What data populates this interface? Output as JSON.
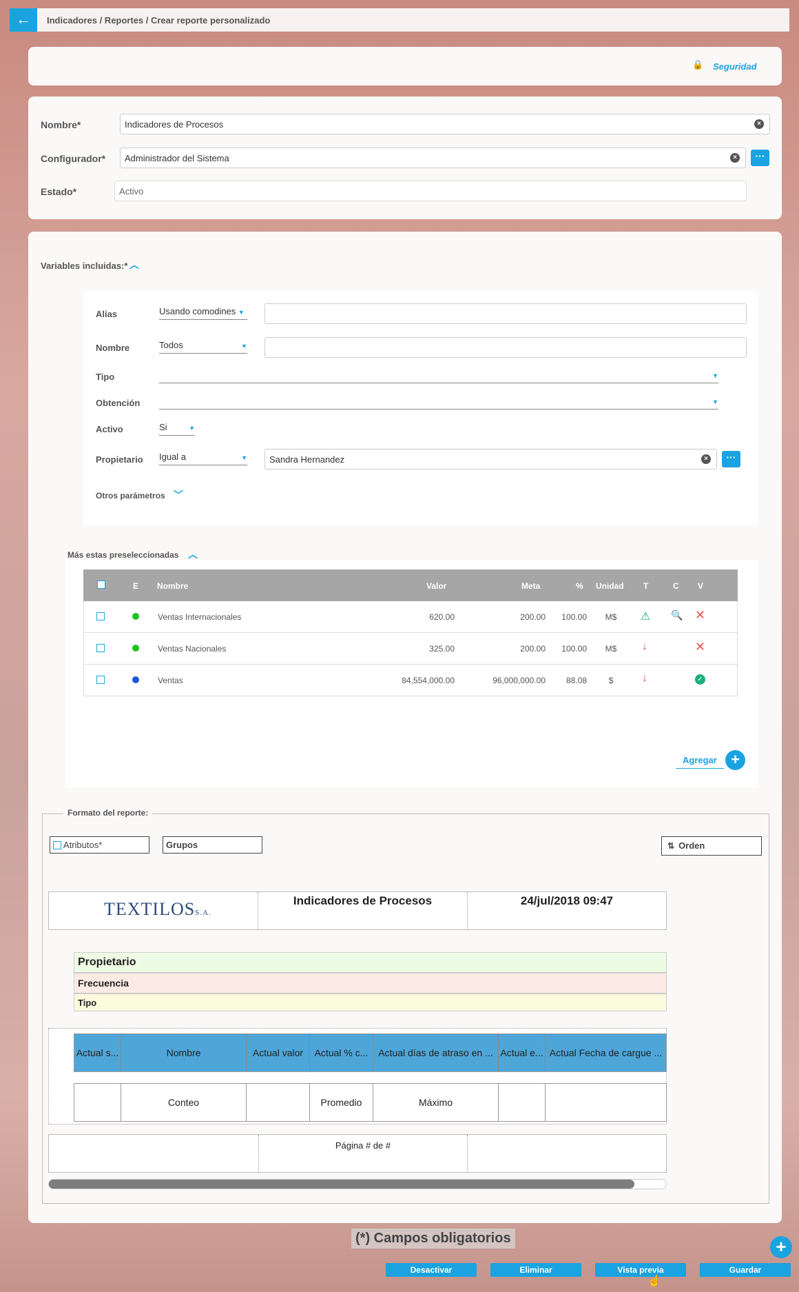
{
  "breadcrumb": "Indicadores / Reportes / Crear reporte personalizado",
  "security": {
    "label": "Seguridad"
  },
  "form": {
    "name_label": "Nombre*",
    "name_value": "Indicadores de Procesos",
    "config_label": "Configurador*",
    "config_value": "Administrador del Sistema",
    "state_label": "Estado*",
    "state_value": "Activo"
  },
  "variables": {
    "title": "Variables incluidas:*",
    "filters": {
      "alias_label": "Alias",
      "alias_mode": "Usando comodines",
      "nombre_label": "Nombre",
      "nombre_mode": "Todos",
      "tipo_label": "Tipo",
      "obtencion_label": "Obtención",
      "activo_label": "Activo",
      "activo_value": "Si",
      "propietario_label": "Propietario",
      "propietario_mode": "Igual a",
      "propietario_value": "Sandra Hernandez",
      "otros_label": "Otros parámetros"
    }
  },
  "preselected": {
    "title": "Más estas preseleccionadas",
    "headers": {
      "e": "E",
      "nombre": "Nombre",
      "valor": "Valor",
      "meta": "Meta",
      "pct": "%",
      "unidad": "Unidad",
      "t": "T",
      "c": "C",
      "v": "V"
    },
    "rows": [
      {
        "nombre": "Ventas Internacionales",
        "valor": "620.00",
        "meta": "200.00",
        "pct": "100.00",
        "unidad": "M$",
        "dot_color": "#1ec41e"
      },
      {
        "nombre": "Ventas Nacionales",
        "valor": "325.00",
        "meta": "200.00",
        "pct": "100.00",
        "unidad": "M$",
        "dot_color": "#1ec41e"
      },
      {
        "nombre": "Ventas",
        "valor": "84,554,000.00",
        "meta": "96,000,000.00",
        "pct": "88.08",
        "unidad": "$",
        "dot_color": "#1a56e0"
      }
    ],
    "add_label": "Agregar"
  },
  "format": {
    "title": "Formato del reporte:",
    "atributos": "Atributos*",
    "grupos": "Grupos",
    "orden": "Orden",
    "logo_main": "TEXTILOS",
    "logo_sub": "S.A.",
    "report_title": "Indicadores de Procesos",
    "report_date": "24/jul/2018 09:47",
    "groups": [
      "Propietario",
      "Frecuencia",
      "Tipo"
    ],
    "columns": [
      "Actual s...",
      "Nombre",
      "Actual valor",
      "Actual % c...",
      "Actual días de atraso en ...",
      "Actual e...",
      "Actual Fecha de cargue ..."
    ],
    "summary": [
      "",
      "Conteo",
      "",
      "Promedio",
      "Máximo",
      "",
      ""
    ],
    "footer": "Página # de #"
  },
  "required_note": "(*) Campos obligatorios",
  "actions": {
    "deactivate": "Desactivar",
    "delete": "Eliminar",
    "preview": "Vista previa",
    "save": "Guardar"
  },
  "colors": {
    "accent": "#1aa3e0",
    "table_header": "#a6a6a6",
    "report_header": "#4ea6d8"
  }
}
